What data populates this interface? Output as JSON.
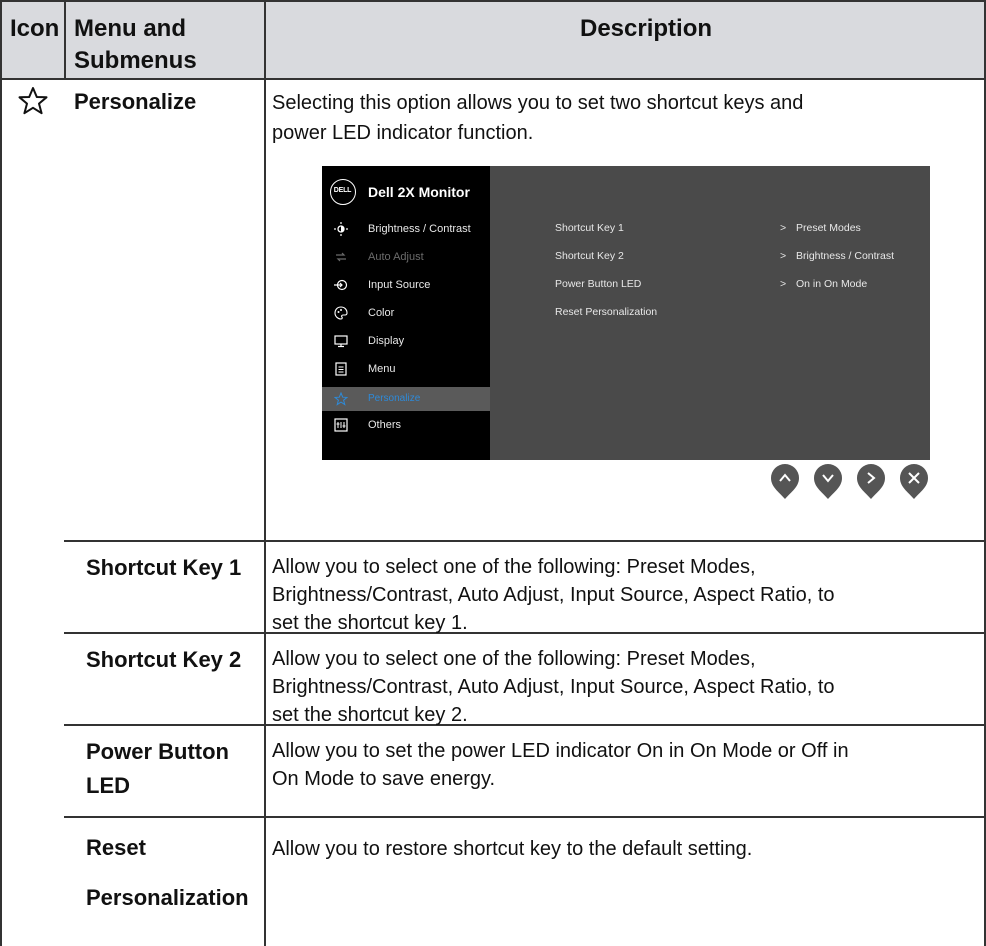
{
  "table": {
    "headers": {
      "icon": "Icon",
      "menu_line1": "Menu and",
      "menu_line2": "Submenus",
      "description": "Description"
    },
    "rows": [
      {
        "icon": "star-icon",
        "menu": "Personalize",
        "desc_line1": "Selecting this option allows you to set two shortcut keys and",
        "desc_line2": "power LED indicator function."
      },
      {
        "menu": "Shortcut Key 1",
        "desc_line1": "Allow you to select one of the following: Preset Modes,",
        "desc_line2": "Brightness/Contrast, Auto Adjust, Input Source, Aspect Ratio, to",
        "desc_line3": "set the shortcut key 1."
      },
      {
        "menu": "Shortcut Key 2",
        "desc_line1": "Allow you to select one of the following: Preset Modes,",
        "desc_line2": "Brightness/Contrast, Auto Adjust, Input Source, Aspect Ratio, to",
        "desc_line3": "set the shortcut key 2."
      },
      {
        "menu_line1": "Power Button",
        "menu_line2": "LED",
        "desc_line1": "Allow you to set the power LED indicator On in On Mode or Off in",
        "desc_line2": "On Mode to save energy."
      },
      {
        "menu_line1": "Reset",
        "menu_line2": "Personalization",
        "desc_line1": "Allow you to restore shortcut key to the default setting."
      }
    ]
  },
  "osd": {
    "logo_text": "DELL",
    "title": "Dell 2X Monitor",
    "menu_items": [
      {
        "label": "Brightness / Contrast",
        "icon": "brightness-icon",
        "state": "normal"
      },
      {
        "label": "Auto Adjust",
        "icon": "auto-adjust-icon",
        "state": "disabled"
      },
      {
        "label": "Input Source",
        "icon": "input-source-icon",
        "state": "normal"
      },
      {
        "label": "Color",
        "icon": "color-icon",
        "state": "normal"
      },
      {
        "label": "Display",
        "icon": "display-icon",
        "state": "normal"
      },
      {
        "label": "Menu",
        "icon": "menu-icon",
        "state": "normal"
      },
      {
        "label": "Personalize",
        "icon": "star-icon",
        "state": "selected"
      },
      {
        "label": "Others",
        "icon": "others-icon",
        "state": "normal"
      }
    ],
    "settings": [
      {
        "label": "Shortcut Key 1",
        "value": "Preset Modes"
      },
      {
        "label": "Shortcut Key 2",
        "value": "Brightness / Contrast"
      },
      {
        "label": "Power Button LED",
        "value": "On in On Mode"
      },
      {
        "label": "Reset Personalization",
        "value": ""
      }
    ],
    "arrow": ">",
    "buttons": [
      "up-button",
      "down-button",
      "right-button",
      "close-button"
    ],
    "colors": {
      "selected_text": "#2e8ad8",
      "panel": "#4a4a4a",
      "sidebar": "#000000"
    }
  }
}
